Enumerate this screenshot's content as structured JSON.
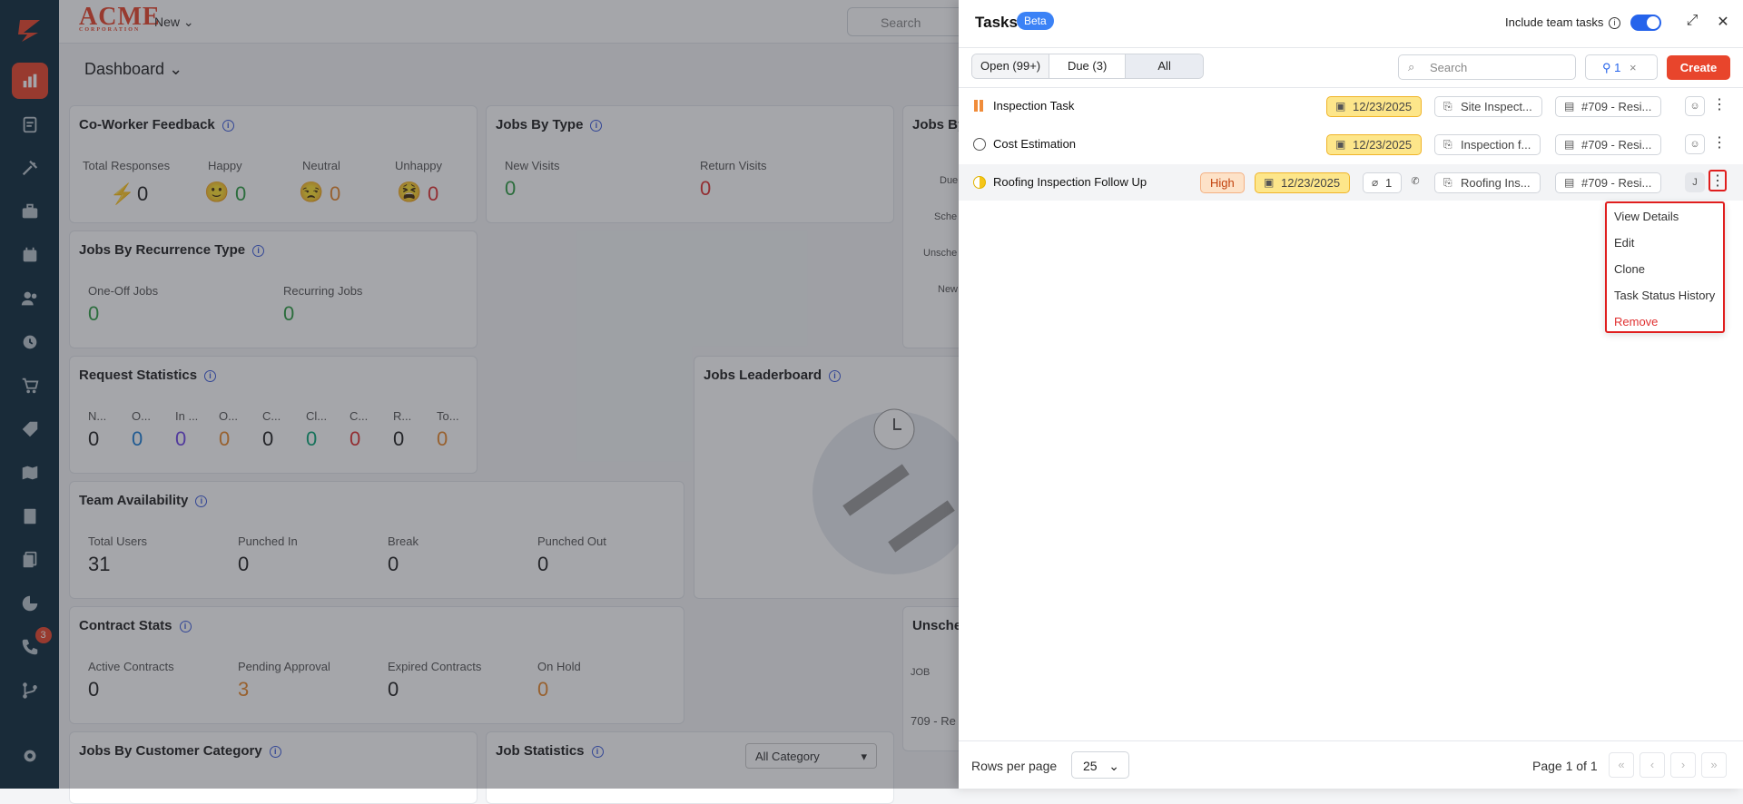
{
  "nav": {
    "badge": "3"
  },
  "topbar": {
    "brand": "ACME",
    "brand_sub": "CORPORATION",
    "new_label": "New",
    "search_placeholder": "Search"
  },
  "dashboard": {
    "title": "Dashboard"
  },
  "cards": {
    "coworker": {
      "title": "Co-Worker Feedback",
      "labels": [
        "Total Responses",
        "Happy",
        "Neutral",
        "Unhappy"
      ],
      "values": [
        "0",
        "0",
        "0",
        "0"
      ]
    },
    "jobs_by_type": {
      "title": "Jobs By Type",
      "labels": [
        "New Visits",
        "Return Visits"
      ],
      "values": [
        "0",
        "0"
      ]
    },
    "jobs_by_3": {
      "title": "Jobs By",
      "labels": [
        "Due",
        "Sche",
        "Unsche",
        "New"
      ]
    },
    "recurrence": {
      "title": "Jobs By Recurrence Type",
      "labels": [
        "One-Off Jobs",
        "Recurring Jobs"
      ],
      "values": [
        "0",
        "0"
      ]
    },
    "request": {
      "title": "Request Statistics",
      "labels": [
        "N...",
        "O...",
        "In ...",
        "O...",
        "C...",
        "Cl...",
        "C...",
        "R...",
        "To..."
      ],
      "values": [
        "0",
        "0",
        "0",
        "0",
        "0",
        "0",
        "0",
        "0",
        "0"
      ]
    },
    "leaderboard": {
      "title": "Jobs Leaderboard"
    },
    "team": {
      "title": "Team Availability",
      "labels": [
        "Total Users",
        "Punched In",
        "Break",
        "Punched Out"
      ],
      "values": [
        "31",
        "0",
        "0",
        "0"
      ]
    },
    "contract": {
      "title": "Contract Stats",
      "labels": [
        "Active Contracts",
        "Pending Approval",
        "Expired Contracts",
        "On Hold"
      ],
      "values": [
        "0",
        "3",
        "0",
        "0"
      ]
    },
    "unsche": {
      "title": "Unsche",
      "col": "JOB",
      "row": "709 - Re"
    },
    "customer_cat": {
      "title": "Jobs By Customer Category"
    },
    "job_stats": {
      "title": "Job Statistics",
      "select": "All Category"
    }
  },
  "panel": {
    "title": "Tasks",
    "beta": "Beta",
    "include_label": "Include team tasks",
    "tabs": [
      "Open (99+)",
      "Due (3)",
      "All"
    ],
    "search_placeholder": "Search",
    "filter_count": "1",
    "create_label": "Create",
    "tasks": [
      {
        "name": "Inspection Task",
        "date": "12/23/2025",
        "related": "Site Inspect...",
        "job": "#709 - Resi..."
      },
      {
        "name": "Cost Estimation",
        "date": "12/23/2025",
        "related": "Inspection f...",
        "job": "#709 - Resi..."
      },
      {
        "name": "Roofing Inspection Follow Up",
        "priority": "High",
        "date": "12/23/2025",
        "attachments": "1",
        "related": "Roofing Ins...",
        "job": "#709 - Resi...",
        "assignee": "J"
      }
    ],
    "menu": [
      "View Details",
      "Edit",
      "Clone",
      "Task Status History",
      "Remove"
    ],
    "footer": {
      "rows_label": "Rows per page",
      "rows_value": "25",
      "page_label": "Page 1 of 1"
    }
  },
  "colors": {
    "accent": "#e8452c",
    "sidebar": "#0f2b3d",
    "link": "#2563eb",
    "date_bg": "#fde68a"
  }
}
